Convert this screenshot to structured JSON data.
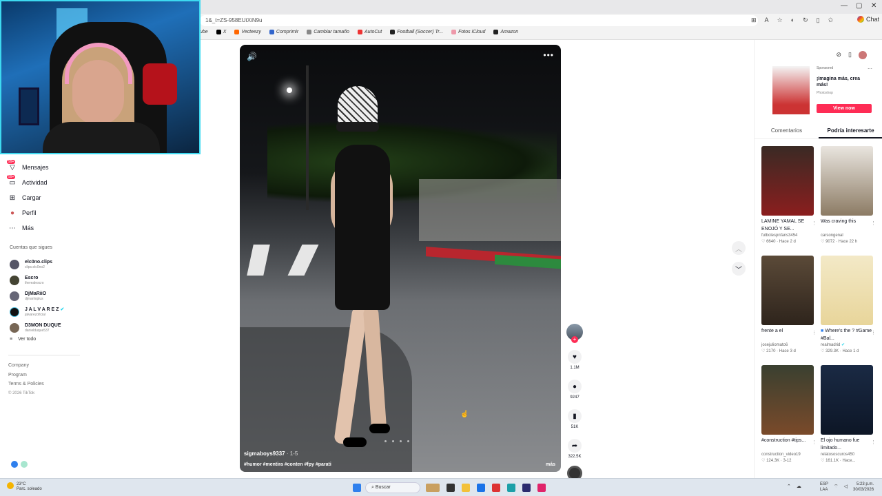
{
  "browser": {
    "url": "1&_t=ZS-958EUtXiN9u",
    "bookmarks": [
      "ube",
      "X",
      "Vecteezy",
      "Comprimir",
      "Cambiar tamaño",
      "AutoCut",
      "Football (Soccer) Tr...",
      "Fotos iCloud",
      "Amazon"
    ],
    "chat_label": "Chat"
  },
  "sidebar": {
    "items": [
      {
        "label": "Mensajes",
        "badge": "99+",
        "icon": "message-icon"
      },
      {
        "label": "Actividad",
        "badge": "99+",
        "icon": "activity-icon"
      },
      {
        "label": "Cargar",
        "icon": "upload-icon"
      },
      {
        "label": "Perfil",
        "icon": "profile-icon"
      },
      {
        "label": "Más",
        "icon": "more-icon"
      }
    ],
    "following_title": "Cuentas que sigues",
    "following": [
      {
        "name": "elc0no.clips",
        "user": "clips.elc0no2"
      },
      {
        "name": "Escro",
        "user": "therealescro"
      },
      {
        "name": "DjMaRiiO",
        "user": "djmariioplus"
      },
      {
        "name": "J A L V A R E Z",
        "user": "jalvarezoficial",
        "verified": true
      },
      {
        "name": "D3MON DUQUE",
        "user": "danielduque537"
      }
    ],
    "see_all": "Ver todo",
    "footer": [
      "Company",
      "Program",
      "Terms & Policies"
    ],
    "copyright": "© 2026 TikTok"
  },
  "video": {
    "author": "sigmaboys9337",
    "date": "· 1-5",
    "tags": "#humor #mentira #conten #fpy #parati",
    "more_label": "más"
  },
  "actions": {
    "likes": "1.1M",
    "comments": "9247",
    "saves": "51K",
    "shares": "322.5K"
  },
  "ad": {
    "sponsored": "Sponsored",
    "title": "¡Imagina más, crea más!",
    "brand": "Photoshop",
    "button": "View now"
  },
  "tabs": [
    "Comentarios",
    "Podría interesarte"
  ],
  "recommended": [
    {
      "title": "LAMINE YAMAL SE ENOJÓ Y SE...",
      "user": "futbolespnfans3454",
      "likes": "6640",
      "ago": "Hace 2 d"
    },
    {
      "title": "Was craving this",
      "user": "carsongenal",
      "likes": "9072",
      "ago": "Hace 22 h"
    },
    {
      "title": "frente a el",
      "user": "josejuliomato6",
      "likes": "2170",
      "ago": "Hace 3 d"
    },
    {
      "title": "Where's the ? #Game #Bal...",
      "user": "realmadrid",
      "likes": "329.3K",
      "ago": "Hace 1 d"
    },
    {
      "title": "#construction #tips...",
      "user": "construction_video19",
      "likes": "124.3K",
      "ago": "3-12"
    },
    {
      "title": "El ojo humano fue limitado...",
      "user": "relatososcuros450",
      "likes": "161.1K",
      "ago": "Hace..."
    }
  ],
  "taskbar": {
    "temp": "23°C",
    "weather": "Parc. soleado",
    "search": "Buscar",
    "lang1": "ESP",
    "lang2": "LAA",
    "time": "5:23 p.m.",
    "date": "30/03/2026"
  }
}
